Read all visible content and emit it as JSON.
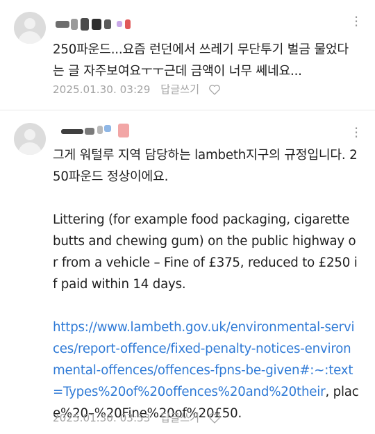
{
  "comments": [
    {
      "text": "250파운드...요즘 런던에서 쓰레기 무단투기 벌금 물었다는 글 자주보여요ㅜㅜ근데 금액이 너무 쎄네요...",
      "date": "2025.01.30. 03:29",
      "reply_label": "답글쓰기"
    },
    {
      "text_part1": "그게 워털루 지역 담당하는 lambeth지구의 규정입니다. 250파운드 정상이에요.\n\nLittering (for example food packaging, cigarette butts and chewing gum) on the public highway or from a vehicle – Fine of £375, reduced to £250 if paid within 14 days.\n\n",
      "link": "https://www.lambeth.gov.uk/environmental-services/report-offence/fixed-penalty-notices-environmental-offences/offences-fpns-be-given#:~:text=Types%20of%20offences%20and%20their",
      "text_part2": ", place%20–%20Fine%20of%20£50.",
      "date": "2025.01.30. 03:53",
      "reply_label": "답글쓰기"
    }
  ],
  "icons": {
    "avatar": "default-user-avatar",
    "more": "more-vertical-icon",
    "like": "heart-outline-icon"
  }
}
